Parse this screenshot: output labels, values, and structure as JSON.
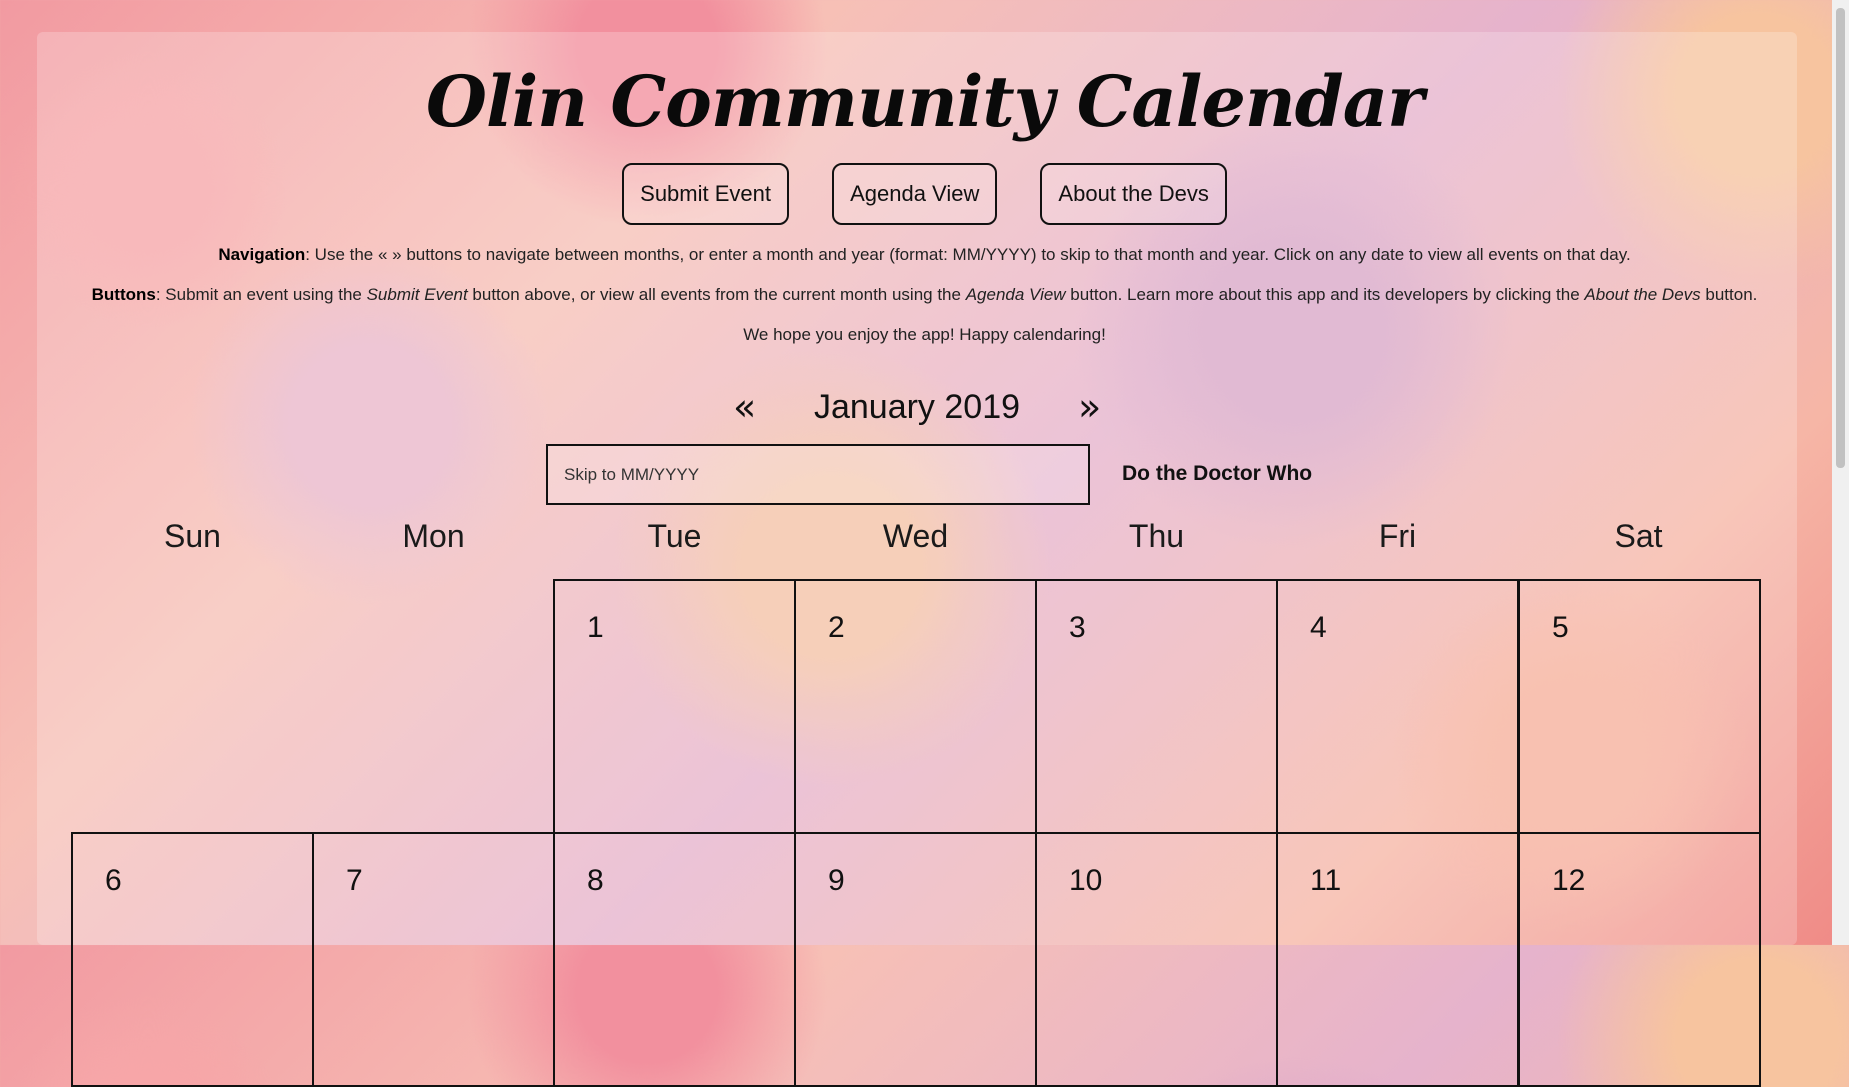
{
  "title": "Olin Community Calendar",
  "buttons": {
    "submit": "Submit Event",
    "agenda": "Agenda View",
    "about": "About the Devs"
  },
  "help": {
    "nav_bold": "Navigation",
    "nav_text": ": Use the « » buttons to navigate between months, or enter a month and year (format: MM/YYYY) to skip to that month and year. Click on any date to view all events on that day.",
    "btn_bold": "Buttons",
    "btn_text1": ": Submit an event using the ",
    "btn_italic1": "Submit Event",
    "btn_text2": " button above, or view all events from the current month using the ",
    "btn_italic2": "Agenda View",
    "btn_text3": " button. Learn more about this app and its developers by clicking the ",
    "btn_italic3": "About the Devs",
    "btn_text4": " button.",
    "enjoy": "We hope you enjoy the app! Happy calendaring!"
  },
  "month": {
    "prev": "«",
    "label": "January 2019",
    "next": "»"
  },
  "skip": {
    "placeholder": "Skip to MM/YYYY"
  },
  "doctor_link": "Do the Doctor Who",
  "days_of_week": [
    "Sun",
    "Mon",
    "Tue",
    "Wed",
    "Thu",
    "Fri",
    "Sat"
  ],
  "weeks": [
    [
      "",
      "",
      "1",
      "2",
      "3",
      "4",
      "5"
    ],
    [
      "6",
      "7",
      "8",
      "9",
      "10",
      "11",
      "12"
    ]
  ]
}
